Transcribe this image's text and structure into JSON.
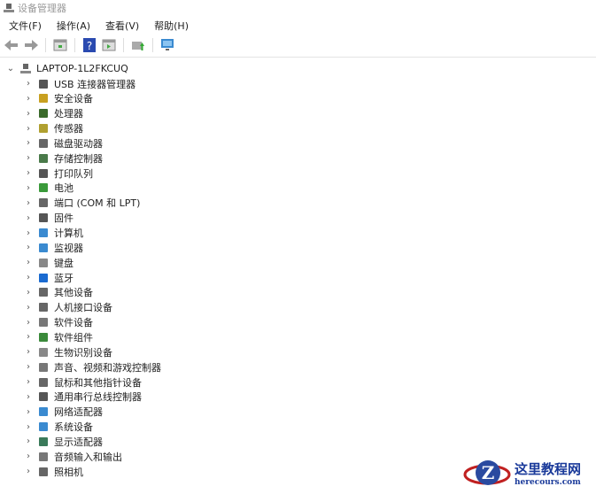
{
  "window": {
    "title": "设备管理器"
  },
  "menu": [
    "文件(F)",
    "操作(A)",
    "查看(V)",
    "帮助(H)"
  ],
  "toolbar": [
    "back-icon",
    "forward-icon",
    "properties-icon",
    "help-icon",
    "show-hide-icon",
    "update-driver-icon",
    "monitor-icon"
  ],
  "tree": {
    "root": "LAPTOP-1L2FKCUQ",
    "items": [
      {
        "label": "USB 连接器管理器",
        "icon": "usb-icon",
        "color": "#555"
      },
      {
        "label": "安全设备",
        "icon": "security-device-icon",
        "color": "#c8a020"
      },
      {
        "label": "处理器",
        "icon": "processor-icon",
        "color": "#3a6a2a"
      },
      {
        "label": "传感器",
        "icon": "sensor-icon",
        "color": "#b0a030"
      },
      {
        "label": "磁盘驱动器",
        "icon": "disk-drive-icon",
        "color": "#666"
      },
      {
        "label": "存储控制器",
        "icon": "storage-controller-icon",
        "color": "#4a7a4a"
      },
      {
        "label": "打印队列",
        "icon": "printer-icon",
        "color": "#555"
      },
      {
        "label": "电池",
        "icon": "battery-icon",
        "color": "#3a9a3a"
      },
      {
        "label": "端口 (COM 和 LPT)",
        "icon": "port-icon",
        "color": "#666"
      },
      {
        "label": "固件",
        "icon": "firmware-icon",
        "color": "#555"
      },
      {
        "label": "计算机",
        "icon": "computer-icon",
        "color": "#3a8ad0"
      },
      {
        "label": "监视器",
        "icon": "monitor-icon",
        "color": "#3a8ad0"
      },
      {
        "label": "键盘",
        "icon": "keyboard-icon",
        "color": "#888"
      },
      {
        "label": "蓝牙",
        "icon": "bluetooth-icon",
        "color": "#1a6ad0"
      },
      {
        "label": "其他设备",
        "icon": "other-device-icon",
        "color": "#666"
      },
      {
        "label": "人机接口设备",
        "icon": "hid-icon",
        "color": "#666"
      },
      {
        "label": "软件设备",
        "icon": "software-device-icon",
        "color": "#777"
      },
      {
        "label": "软件组件",
        "icon": "software-component-icon",
        "color": "#3a8a3a"
      },
      {
        "label": "生物识别设备",
        "icon": "biometric-icon",
        "color": "#888"
      },
      {
        "label": "声音、视频和游戏控制器",
        "icon": "sound-icon",
        "color": "#777"
      },
      {
        "label": "鼠标和其他指针设备",
        "icon": "mouse-icon",
        "color": "#666"
      },
      {
        "label": "通用串行总线控制器",
        "icon": "usb-controller-icon",
        "color": "#555"
      },
      {
        "label": "网络适配器",
        "icon": "network-adapter-icon",
        "color": "#3a8ad0"
      },
      {
        "label": "系统设备",
        "icon": "system-device-icon",
        "color": "#3a8ad0"
      },
      {
        "label": "显示适配器",
        "icon": "display-adapter-icon",
        "color": "#3a7a5a"
      },
      {
        "label": "音频输入和输出",
        "icon": "audio-io-icon",
        "color": "#777"
      },
      {
        "label": "照相机",
        "icon": "camera-icon",
        "color": "#666"
      }
    ]
  },
  "watermark": {
    "title": "这里教程网",
    "url": "herecours.com"
  }
}
